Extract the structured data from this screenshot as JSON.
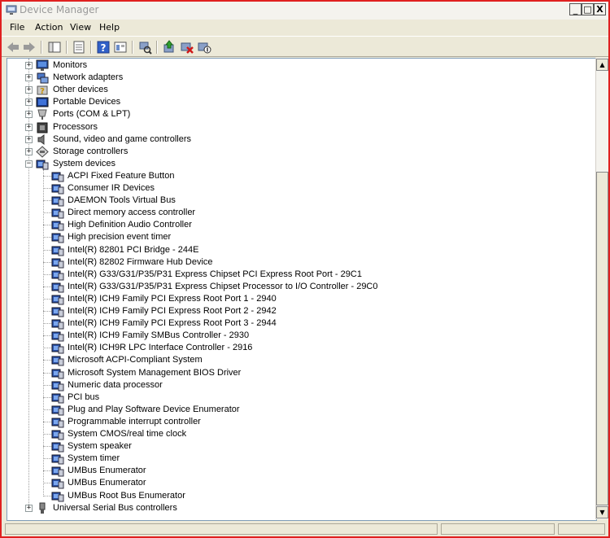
{
  "window": {
    "title": "Device Manager",
    "minimize_label": "_",
    "maximize_label": "□",
    "close_label": "X"
  },
  "menu": [
    "File",
    "Action",
    "View",
    "Help"
  ],
  "toolbar": [
    "back-icon",
    "forward-icon",
    "show-hide-console-tree-icon",
    "properties-icon",
    "help-icon",
    "view-icon",
    "scan-hardware-icon",
    "update-driver-icon",
    "uninstall-icon",
    "disable-icon"
  ],
  "tree": {
    "categories_before": [
      {
        "label": "Monitors",
        "icon": "monitor-icon"
      },
      {
        "label": "Network adapters",
        "icon": "network-adapter-icon"
      },
      {
        "label": "Other devices",
        "icon": "unknown-device-icon"
      },
      {
        "label": "Portable Devices",
        "icon": "portable-device-icon"
      },
      {
        "label": "Ports (COM & LPT)",
        "icon": "port-icon"
      },
      {
        "label": "Processors",
        "icon": "processor-icon"
      },
      {
        "label": "Sound, video and game controllers",
        "icon": "sound-icon"
      },
      {
        "label": "Storage controllers",
        "icon": "storage-controller-icon"
      }
    ],
    "expanded": {
      "label": "System devices",
      "icon": "system-device-icon",
      "children": [
        "ACPI Fixed Feature Button",
        "Consumer IR Devices",
        "DAEMON Tools Virtual Bus",
        "Direct memory access controller",
        "High Definition Audio Controller",
        "High precision event timer",
        "Intel(R) 82801 PCI Bridge - 244E",
        "Intel(R) 82802 Firmware Hub Device",
        "Intel(R) G33/G31/P35/P31 Express Chipset PCI Express Root Port - 29C1",
        "Intel(R) G33/G31/P35/P31 Express Chipset Processor to I/O Controller - 29C0",
        "Intel(R) ICH9 Family PCI Express Root Port 1 - 2940",
        "Intel(R) ICH9 Family PCI Express Root Port 2 - 2942",
        "Intel(R) ICH9 Family PCI Express Root Port 3 - 2944",
        "Intel(R) ICH9 Family SMBus Controller - 2930",
        "Intel(R) ICH9R LPC Interface Controller - 2916",
        "Microsoft ACPI-Compliant System",
        "Microsoft System Management BIOS Driver",
        "Numeric data processor",
        "PCI bus",
        "Plug and Play Software Device Enumerator",
        "Programmable interrupt controller",
        "System CMOS/real time clock",
        "System speaker",
        "System timer",
        "UMBus Enumerator",
        "UMBus Enumerator",
        "UMBus Root Bus Enumerator"
      ]
    },
    "categories_after": [
      {
        "label": "Universal Serial Bus controllers",
        "icon": "usb-icon"
      }
    ],
    "expand_symbol": "+",
    "collapse_symbol": "−"
  },
  "colors": {
    "frame_border": "#e02020",
    "chrome": "#ece9d8",
    "tree_background": "#ffffff"
  }
}
